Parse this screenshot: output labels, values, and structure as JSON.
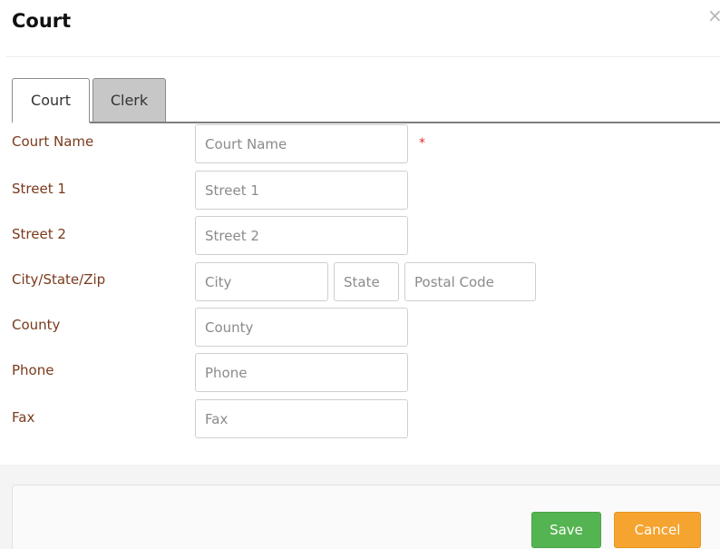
{
  "dialog": {
    "title": "Court",
    "close_glyph": "×"
  },
  "tabs": [
    {
      "label": "Court",
      "active": true
    },
    {
      "label": "Clerk",
      "active": false
    }
  ],
  "form": {
    "court_name": {
      "label": "Court Name",
      "placeholder": "Court Name",
      "value": "",
      "required_marker": "*"
    },
    "street1": {
      "label": "Street 1",
      "placeholder": "Street 1",
      "value": ""
    },
    "street2": {
      "label": "Street 2",
      "placeholder": "Street 2",
      "value": ""
    },
    "city_state_zip": {
      "label": "City/State/Zip",
      "city_placeholder": "City",
      "state_placeholder": "State",
      "zip_placeholder": "Postal Code"
    },
    "county": {
      "label": "County",
      "placeholder": "County",
      "value": ""
    },
    "phone": {
      "label": "Phone",
      "placeholder": "Phone",
      "value": ""
    },
    "fax": {
      "label": "Fax",
      "placeholder": "Fax",
      "value": ""
    }
  },
  "buttons": {
    "save": "Save",
    "cancel": "Cancel"
  },
  "colors": {
    "label": "#7a3a1c",
    "required": "#e03030",
    "save": "#55b452",
    "cancel": "#f5a42f",
    "inactive_tab": "#c7c7c7"
  },
  "icons": {
    "close": "close-icon"
  }
}
